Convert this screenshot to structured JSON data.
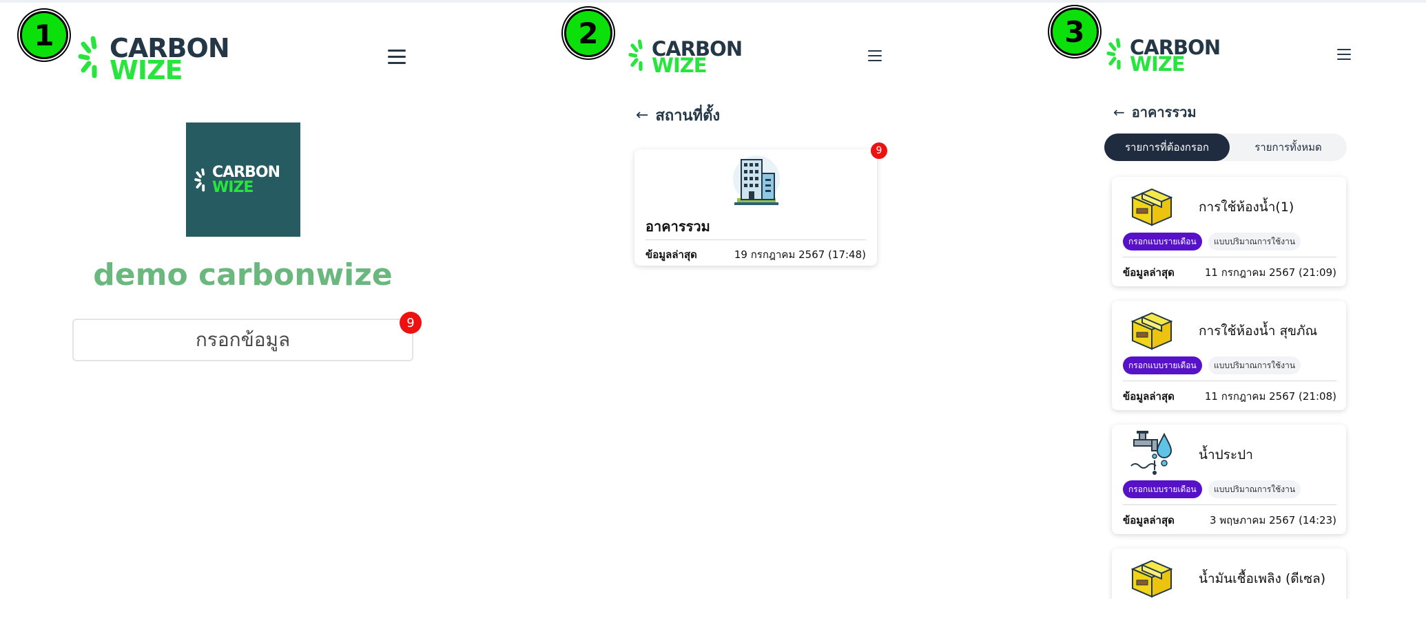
{
  "steps": [
    "1",
    "2",
    "3"
  ],
  "logo": {
    "line1": "CARBON",
    "line2": "WIZE"
  },
  "colors": {
    "accent_green": "#27e53c",
    "navy": "#243746",
    "brand_teal": "#255b61",
    "badge_red": "#ee1111",
    "purple": "#5711c9"
  },
  "panel1": {
    "brand_logo": {
      "line1": "CARBON",
      "line2": "WIZE"
    },
    "org_name": "demo carbonwize",
    "fill_button": "กรอกข้อมูล",
    "badge_count": "9"
  },
  "panel2": {
    "back_title": "สถานที่ตั้ง",
    "location_card": {
      "name": "อาคารรวม",
      "latest_label": "ข้อมูลล่าสุด",
      "latest_value": "19 กรกฎาคม 2567 (17:48)",
      "badge_count": "9",
      "icon": "building-icon"
    }
  },
  "panel3": {
    "back_title": "อาคารรวม",
    "tabs": [
      "รายการที่ต้องกรอก",
      "รายการทั้งหมด"
    ],
    "active_tab": 0,
    "items": [
      {
        "title": "การใช้ห้องน้ำ(1)",
        "tag1": "กรอกแบบรายเดือน",
        "tag2": "แบบปริมาณการใช้งาน",
        "latest_label": "ข้อมูลล่าสุด",
        "latest_value": "11 กรกฎาคม 2567 (21:09)",
        "icon": "box-icon"
      },
      {
        "title": "การใช้ห้องน้ำ สุขภัณ",
        "tag1": "กรอกแบบรายเดือน",
        "tag2": "แบบปริมาณการใช้งาน",
        "latest_label": "ข้อมูลล่าสุด",
        "latest_value": "11 กรกฎาคม 2567 (21:08)",
        "icon": "box-icon"
      },
      {
        "title": "น้ำประปา",
        "tag1": "กรอกแบบรายเดือน",
        "tag2": "แบบปริมาณการใช้งาน",
        "latest_label": "ข้อมูลล่าสุด",
        "latest_value": "3 พฤษภาคม 2567 (14:23)",
        "icon": "water-tap-icon"
      },
      {
        "title": "น้ำมันเชื้อเพลิง (ดีเซล)",
        "icon": "box-icon"
      }
    ]
  }
}
